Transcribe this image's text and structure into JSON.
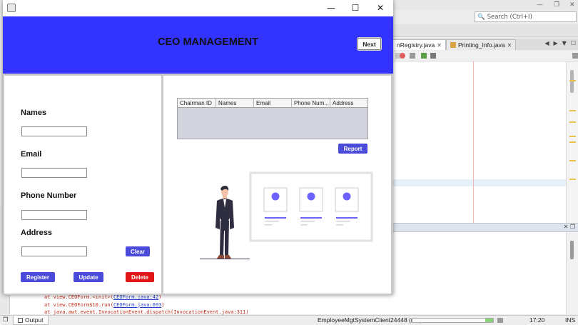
{
  "ide": {
    "search_placeholder": "Search (Ctrl+I)",
    "tabs": [
      {
        "label": "nRegistry.java",
        "active": true
      },
      {
        "label": "Printing_Info.java",
        "active": false
      }
    ],
    "output_lines": [
      {
        "prefix": "at view.CEOForm.<init>(",
        "link": "CEOForm.java:42",
        "suffix": ")"
      },
      {
        "prefix": "at view.CEOForm$10.run(",
        "link": "CEOForm.java:693",
        "suffix": ")"
      },
      {
        "prefix": "at java.awt.event.InvocationEvent.dispatch(InvocationEvent.java:311)",
        "link": "",
        "suffix": ""
      }
    ],
    "status": {
      "output_tab": "Output",
      "run_label": "EmployeeMgtSystemClient24448 (run)",
      "time": "17:20",
      "mode": "INS",
      "progress": 0.1
    }
  },
  "app": {
    "title_controls": {
      "minimize": "—",
      "maximize": "☐",
      "close": "✕"
    },
    "banner": {
      "title": "CEO MANAGEMENT",
      "next_label": "Next",
      "color": "#3333ff"
    },
    "form": {
      "fields": [
        {
          "label": "Names",
          "value": ""
        },
        {
          "label": "Email",
          "value": ""
        },
        {
          "label": "Phone Number",
          "value": ""
        },
        {
          "label": "Address",
          "value": ""
        }
      ],
      "clear_label": "Clear",
      "register_label": "Register",
      "update_label": "Update",
      "delete_label": "Delete"
    },
    "table": {
      "columns": [
        "Chairman ID",
        "Names",
        "Email",
        "Phone Num...",
        "Address"
      ],
      "rows": []
    },
    "report_label": "Report",
    "colors": {
      "accent_button": "#4a4adb",
      "danger_button": "#e11616",
      "illustration_accent": "#6c63ff"
    }
  }
}
